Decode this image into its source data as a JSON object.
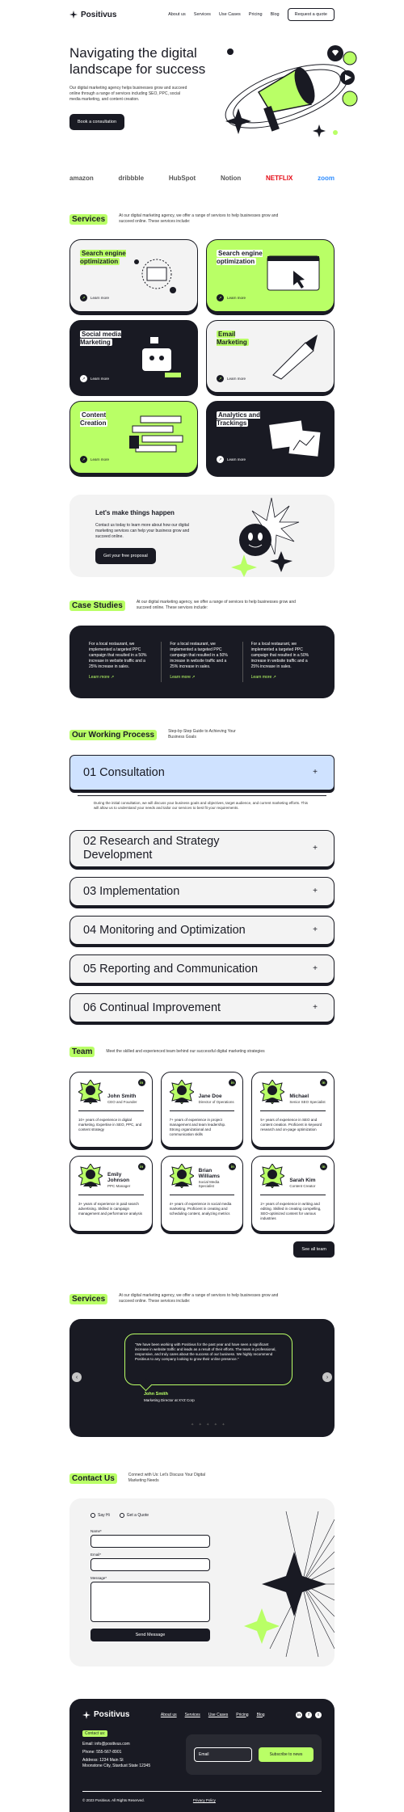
{
  "header": {
    "logo": "Positivus",
    "nav": [
      "About us",
      "Services",
      "Use Cases",
      "Pricing",
      "Blog"
    ],
    "cta": "Request a quote"
  },
  "hero": {
    "title": "Navigating the digital landscape for success",
    "text": "Our digital marketing agency helps businesses grow and succeed online through a range of services including SEO, PPC, social media marketing, and content creation.",
    "button": "Book a consultation"
  },
  "logos": [
    "amazon",
    "dribbble",
    "HubSpot",
    "Notion",
    "NETFLIX",
    "zoom"
  ],
  "services": {
    "tag": "Services",
    "desc": "At our digital marketing agency, we offer a range of services to help businesses grow and succeed online. These services include:",
    "learn": "Learn more",
    "cards": [
      {
        "title": "Search engine optimization",
        "style": "light"
      },
      {
        "title": "Search engine optimization",
        "style": "lime"
      },
      {
        "title": "Social media Marketing",
        "style": "dark"
      },
      {
        "title": "Email Marketing",
        "style": "light"
      },
      {
        "title": "Content Creation",
        "style": "lime"
      },
      {
        "title": "Analytics and Trackings",
        "style": "dark"
      }
    ]
  },
  "cta": {
    "title": "Let's make things happen",
    "text": "Contact us today to learn more about how our digital marketing services can help your business grow and succeed online.",
    "button": "Get your free proposal"
  },
  "case_studies": {
    "tag": "Case Studies",
    "desc": "At our digital marketing agency, we offer a range of services to help businesses grow and succeed online. These services include:",
    "items": [
      "For a local restaurant, we implemented a targeted PPC campaign that resulted in a 50% increase in website traffic and a 25% increase in sales.",
      "For a local restaurant, we implemented a targeted PPC campaign that resulted in a 50% increase in website traffic and a 25% increase in sales.",
      "For a local restaurant, we implemented a targeted PPC campaign that resulted in a 50% increase in website traffic and a 25% increase in sales."
    ],
    "link": "Learn more ↗"
  },
  "process": {
    "tag": "Our Working Process",
    "desc": "Step-by-Step Guide to Achieving Your Business Goals",
    "steps": [
      "01 Consultation",
      "02 Research and Strategy Development",
      "03 Implementation",
      "04 Monitoring and Optimization",
      "05 Reporting and Communication",
      "06 Continual Improvement"
    ],
    "open_body": "During the initial consultation, we will discuss your business goals and objectives, target audience, and current marketing efforts. This will allow us to understand your needs and tailor our services to best fit your requirements.",
    "plus": "+"
  },
  "team": {
    "tag": "Team",
    "desc": "Meet the skilled and experienced team behind our successful digital marketing strategies",
    "members": [
      {
        "name": "John Smith",
        "role": "CEO and Founder",
        "bio": "10+ years of experience in digital marketing. Expertise in SEO, PPC, and content strategy"
      },
      {
        "name": "Jane Doe",
        "role": "Director of Operations",
        "bio": "7+ years of experience in project management and team leadership. Strong organizational and communication skills"
      },
      {
        "name": "Michael",
        "role": "Senior SEO Specialist",
        "bio": "5+ years of experience in SEO and content creation. Proficient in keyword research and on-page optimization"
      },
      {
        "name": "Emily Johnson",
        "role": "PPC Manager",
        "bio": "3+ years of experience in paid search advertising. Skilled in campaign management and performance analysis"
      },
      {
        "name": "Brian Williams",
        "role": "Social Media Specialist",
        "bio": "4+ years of experience in social media marketing. Proficient in creating and scheduling content, analyzing metrics"
      },
      {
        "name": "Sarah Kim",
        "role": "Content Creator",
        "bio": "2+ years of experience in writing and editing. Skilled in creating compelling, SEO-optimized content for various industries"
      }
    ],
    "linkedin": "in",
    "see_all": "See all team"
  },
  "testimonials": {
    "tag": "Services",
    "desc": "At our digital marketing agency, we offer a range of services to help businesses grow and succeed online. These services include:",
    "quote": "\"We have been working with Positivus for the past year and have seen a significant increase in website traffic and leads as a result of their efforts. The team is professional, responsive, and truly cares about the success of our business. We highly recommend Positivus to any company looking to grow their online presence.\"",
    "name": "John Smith",
    "role": "Marketing Director at XYZ Corp",
    "prev": "‹",
    "next": "›",
    "dots": "✦ ✦ ✦ ✦ ✦"
  },
  "contact": {
    "tag": "Contact Us",
    "desc": "Connect with Us: Let's Discuss Your Digital Marketing Needs",
    "radio1": "Say Hi",
    "radio2": "Get a Quote",
    "name_label": "Name*",
    "email_label": "Email*",
    "message_label": "Message*",
    "send": "Send Message"
  },
  "footer": {
    "logo": "Positivus",
    "nav": [
      "About us",
      "Services",
      "Use Cases",
      "Pricing",
      "Blog"
    ],
    "social": [
      "in",
      "f",
      "t"
    ],
    "contact_tag": "Contact us:",
    "email_line": "Email: info@positivus.com",
    "phone_line": "Phone: 555-567-8901",
    "address_line1": "Address: 1234 Main St",
    "address_line2": "Moonstone City, Stardust State 12345",
    "email_placeholder": "Email",
    "subscribe": "Subscribe to news",
    "copyright": "© 2023 Positivus. All Rights Reserved.",
    "privacy": "Privacy Policy"
  }
}
